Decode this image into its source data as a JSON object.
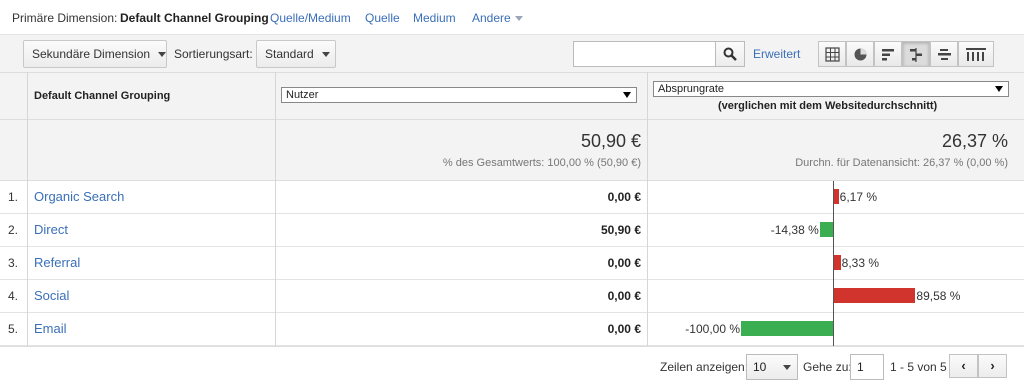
{
  "dimension_bar": {
    "label": "Primäre Dimension:",
    "active": "Default Channel Grouping",
    "links": [
      "Quelle/Medium",
      "Quelle",
      "Medium"
    ],
    "more": "Andere"
  },
  "toolbar": {
    "secondary_dimension": "Sekundäre Dimension",
    "sort_label": "Sortierungsart:",
    "sort_value": "Standard",
    "search_value": "",
    "advanced_link": "Erweitert"
  },
  "table": {
    "col_dimension": "Default Channel Grouping",
    "metric_select": "Nutzer",
    "comparison_select": "Absprungrate",
    "comparison_sub": "(verglichen mit dem Websitedurchschnitt)",
    "totals": {
      "metric_value": "50,90 €",
      "metric_note": "% des Gesamtwerts: 100,00 % (50,90 €)",
      "comparison_value": "26,37 %",
      "comparison_note": "Durchn. für Datenansicht: 26,37 % (0,00 %)"
    },
    "rows": [
      {
        "index": "1.",
        "name": "Organic Search",
        "value": "0,00 €",
        "delta_label": "6,17 %",
        "delta": 6.17
      },
      {
        "index": "2.",
        "name": "Direct",
        "value": "50,90 €",
        "delta_label": "-14,38 %",
        "delta": -14.38
      },
      {
        "index": "3.",
        "name": "Referral",
        "value": "0,00 €",
        "delta_label": "8,33 %",
        "delta": 8.33
      },
      {
        "index": "4.",
        "name": "Social",
        "value": "0,00 €",
        "delta_label": "89,58 %",
        "delta": 89.58
      },
      {
        "index": "5.",
        "name": "Email",
        "value": "0,00 €",
        "delta_label": "-100,00 %",
        "delta": -100.0
      }
    ]
  },
  "footer": {
    "rows_label": "Zeilen anzeigen:",
    "rows_value": "10",
    "goto_label": "Gehe zu:",
    "goto_value": "1",
    "range": "1 - 5 von 5",
    "prev": "‹",
    "next": "›"
  },
  "colors": {
    "link": "#3a6fb8",
    "positive_bar": "#d0342c",
    "negative_bar": "#3cae52"
  }
}
